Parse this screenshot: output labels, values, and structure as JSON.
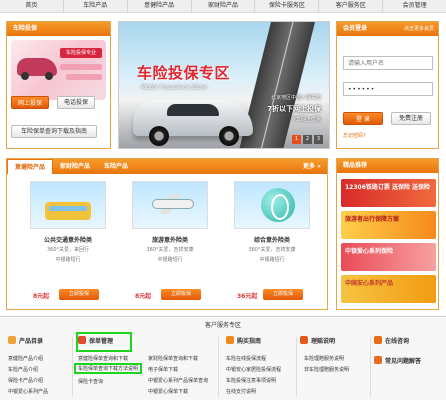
{
  "nav": {
    "items": [
      "首页",
      "车险产品",
      "意健险产品",
      "家财险产品",
      "保险卡服务区",
      "客户服务区",
      "会员管理"
    ]
  },
  "car_panel": {
    "title": "车险投保",
    "promo_tag": "车险投保专业",
    "btn_online": "网上投保",
    "btn_phone": "电话投保",
    "btn_guide": "车险保单查询下载及指南"
  },
  "banner": {
    "title": "车险投保专区",
    "subtitle": "Motor Insurance Zone",
    "line1": "北京地区中国人保车险",
    "line2": "7折以下网上投保",
    "line3": "专享网上优惠",
    "pages": [
      "1",
      "2",
      "3"
    ]
  },
  "login": {
    "title": "会员登录",
    "more": "点击更多会员",
    "username_placeholder": "请输入用户名",
    "password_value": "••••••",
    "btn_login": "登 录",
    "btn_register": "免费注册",
    "forgot": "忘记密码？"
  },
  "products": {
    "tabs": [
      "意健险产品",
      "家财险产品",
      "车险产品"
    ],
    "more": "更多 »",
    "cards": [
      {
        "name": "公共交通意外险类",
        "desc1": "360°关爱，来回行",
        "desc2": "中银路短行",
        "price": "8元起",
        "buy": "立即投保",
        "icon": "bus-image"
      },
      {
        "name": "旅游意外险类",
        "desc1": "360°关爱，吉祥安康",
        "desc2": "中银路短行",
        "price": "8元起",
        "buy": "立即投保",
        "icon": "plane-image"
      },
      {
        "name": "综合意外险类",
        "desc1": "360°关爱，吉祥安康",
        "desc2": "中银路短行",
        "price": "36元起",
        "buy": "立即投保",
        "icon": "globe-image"
      }
    ]
  },
  "features": {
    "title": "精品推荐",
    "items": [
      "12306铁路订票 送保险 送保险",
      "旅游者出行保障方案",
      "中银爱心系列保险",
      "中国安心系列产品"
    ]
  },
  "service": {
    "title": "客户服务专区",
    "sections": [
      {
        "head": "产品目录",
        "links": [
          "意健险产品介绍",
          "车险产品介绍",
          "保险卡产品介绍",
          "中银爱心系列产品"
        ]
      },
      {
        "head": "保单管理",
        "links": [
          "意健险保单查询和下载",
          "车险保单查询下载方法说明",
          "保险卡查询"
        ]
      },
      {
        "head": "",
        "links": [
          "家财险保单查询和下载",
          "电子保单下载",
          "中银爱心系列产品保单查询",
          "中银爱心保单下载"
        ]
      },
      {
        "head": "购买指南",
        "links": [
          "车险在线投保流程",
          "中银安心家居险投保流程",
          "车险投保注意事项说明",
          "在线支付说明"
        ]
      },
      {
        "head": "理赔说明",
        "links": [
          "车险理赔服务说明",
          "非车险理赔服务说明"
        ]
      },
      {
        "head": "在线咨询",
        "links": []
      },
      {
        "head": "常见问题解答",
        "links": []
      }
    ]
  },
  "colors": {
    "accent": "#e9740d",
    "highlight": "#1fd41f"
  }
}
